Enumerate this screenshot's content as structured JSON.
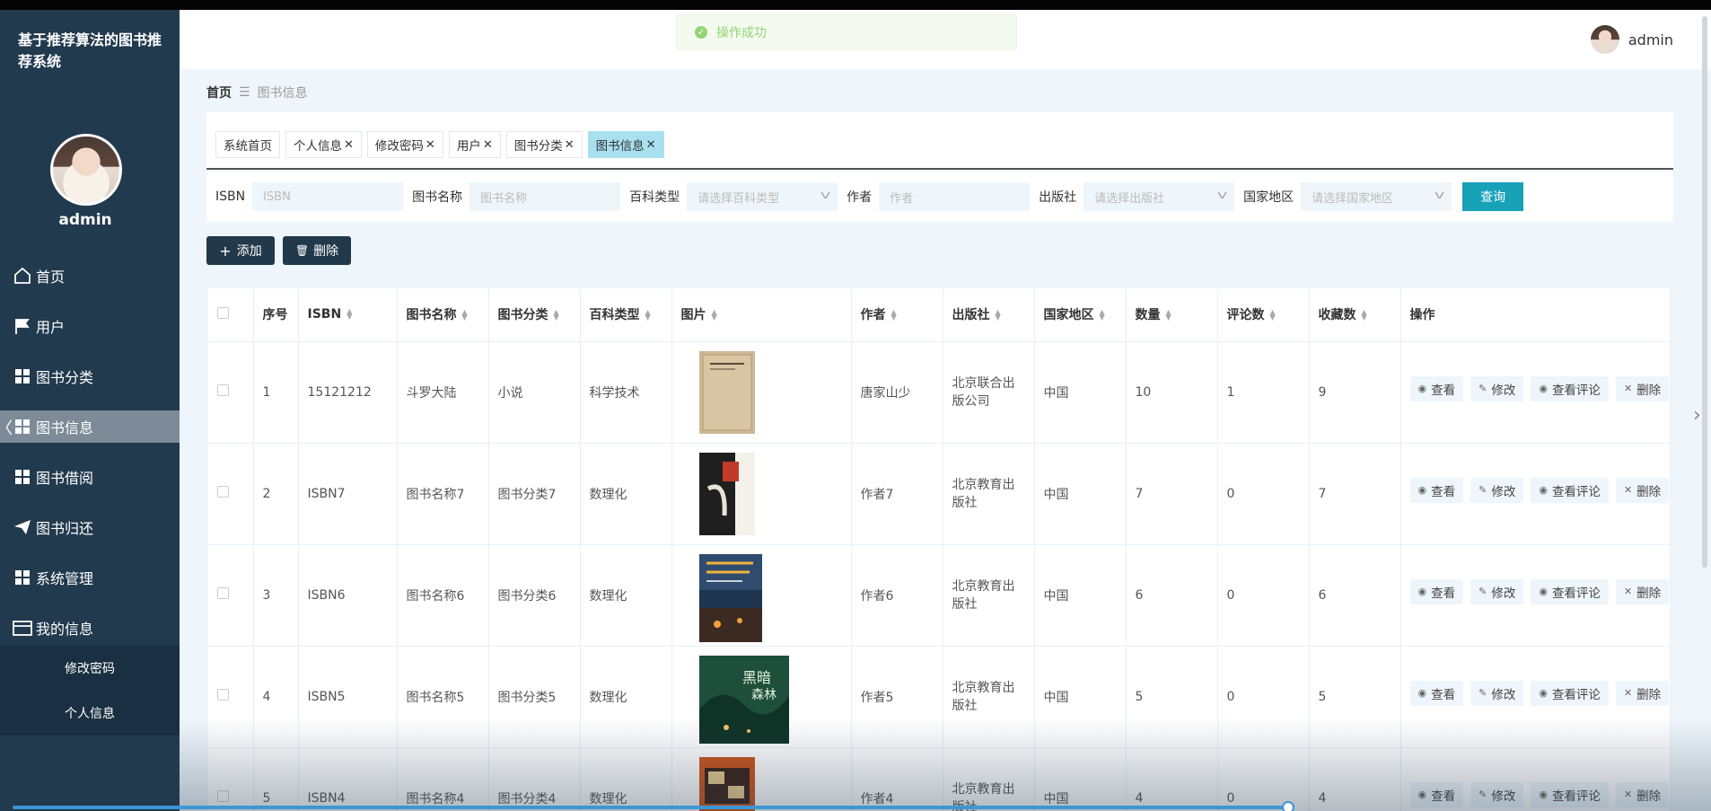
{
  "app": {
    "title": "基于推荐算法的图书推荐系统",
    "user": "admin"
  },
  "toast": {
    "text": "操作成功"
  },
  "sidebar": {
    "items": [
      {
        "label": "首页",
        "icon": "home-icon"
      },
      {
        "label": "用户",
        "icon": "flag-icon"
      },
      {
        "label": "图书分类",
        "icon": "grid-icon"
      },
      {
        "label": "图书信息",
        "icon": "grid-icon",
        "active": true
      },
      {
        "label": "图书借阅",
        "icon": "grid-icon"
      },
      {
        "label": "图书归还",
        "icon": "send-icon"
      },
      {
        "label": "系统管理",
        "icon": "grid-icon"
      },
      {
        "label": "我的信息",
        "icon": "card-icon"
      }
    ],
    "submenu": [
      "修改密码",
      "个人信息"
    ]
  },
  "breadcrumb": {
    "home": "首页",
    "current": "图书信息"
  },
  "tabs": [
    {
      "label": "系统首页",
      "closable": false
    },
    {
      "label": "个人信息",
      "closable": true
    },
    {
      "label": "修改密码",
      "closable": true
    },
    {
      "label": "用户",
      "closable": true
    },
    {
      "label": "图书分类",
      "closable": true
    },
    {
      "label": "图书信息",
      "closable": true,
      "active": true
    }
  ],
  "search": {
    "isbn_label": "ISBN",
    "isbn_placeholder": "ISBN",
    "name_label": "图书名称",
    "name_placeholder": "图书名称",
    "type_label": "百科类型",
    "type_placeholder": "请选择百科类型",
    "author_label": "作者",
    "author_placeholder": "作者",
    "publisher_label": "出版社",
    "publisher_placeholder": "请选择出版社",
    "region_label": "国家地区",
    "region_placeholder": "请选择国家地区",
    "query_button": "查询"
  },
  "actions": {
    "add": "添加",
    "delete": "删除"
  },
  "table": {
    "headers": [
      "序号",
      "ISBN",
      "图书名称",
      "图书分类",
      "百科类型",
      "图片",
      "作者",
      "出版社",
      "国家地区",
      "数量",
      "评论数",
      "收藏数",
      "操作"
    ],
    "op_labels": {
      "view": "查看",
      "edit": "修改",
      "comments": "查看评论",
      "delete": "删除"
    },
    "rows": [
      {
        "no": "1",
        "isbn": "15121212",
        "name": "斗罗大陆",
        "category": "小说",
        "type": "科学技术",
        "author": "唐家山少",
        "publisher": "北京联合出版公司",
        "region": "中国",
        "qty": "10",
        "comments": "1",
        "favorites": "9"
      },
      {
        "no": "2",
        "isbn": "ISBN7",
        "name": "图书名称7",
        "category": "图书分类7",
        "type": "数理化",
        "author": "作者7",
        "publisher": "北京教育出版社",
        "region": "中国",
        "qty": "7",
        "comments": "0",
        "favorites": "7"
      },
      {
        "no": "3",
        "isbn": "ISBN6",
        "name": "图书名称6",
        "category": "图书分类6",
        "type": "数理化",
        "author": "作者6",
        "publisher": "北京教育出版社",
        "region": "中国",
        "qty": "6",
        "comments": "0",
        "favorites": "6"
      },
      {
        "no": "4",
        "isbn": "ISBN5",
        "name": "图书名称5",
        "category": "图书分类5",
        "type": "数理化",
        "author": "作者5",
        "publisher": "北京教育出版社",
        "region": "中国",
        "qty": "5",
        "comments": "0",
        "favorites": "5"
      },
      {
        "no": "5",
        "isbn": "ISBN4",
        "name": "图书名称4",
        "category": "图书分类4",
        "type": "数理化",
        "author": "作者4",
        "publisher": "北京教育出版社",
        "region": "中国",
        "qty": "4",
        "comments": "0",
        "favorites": "4"
      }
    ]
  }
}
